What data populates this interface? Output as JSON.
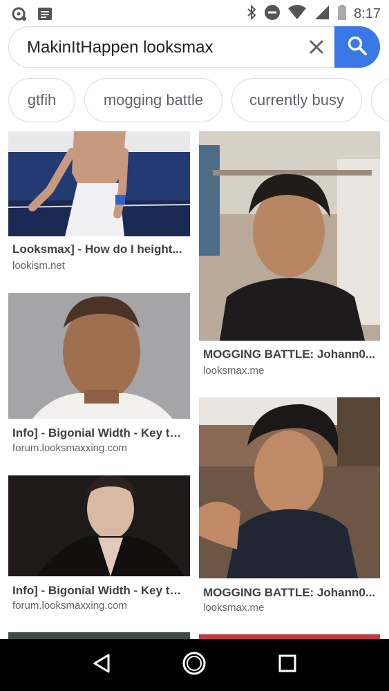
{
  "status_bar": {
    "time": "8:17",
    "icons": [
      "notification-dot-icon",
      "message-icon",
      "bluetooth-icon",
      "do-not-disturb-icon",
      "wifi-icon",
      "cell-signal-icon",
      "battery-icon"
    ]
  },
  "search": {
    "query": "MakinItHappen looksmax",
    "clear_icon": "close-icon",
    "submit_icon": "search-icon",
    "accent": "#3b78e7"
  },
  "chips": [
    {
      "label": "gtfih"
    },
    {
      "label": "mogging battle"
    },
    {
      "label": "currently busy"
    },
    {
      "label": ""
    }
  ],
  "results": [
    {
      "title": "Looksmax] - How do I height...",
      "source": "lookism.net"
    },
    {
      "title": "MOGGING BATTLE: Johann0...",
      "source": "looksmax.me"
    },
    {
      "title": "Info] - Bigonial Width - Key to ...",
      "source": "forum.looksmaxxing.com"
    },
    {
      "title": "MOGGING BATTLE: Johann0...",
      "source": "looksmax.me"
    },
    {
      "title": "Info] - Bigonial Width - Key to ...",
      "source": "forum.looksmaxxing.com"
    }
  ],
  "nav_bar": {
    "back_icon": "back-icon",
    "home_icon": "home-icon",
    "recents_icon": "recents-icon"
  }
}
